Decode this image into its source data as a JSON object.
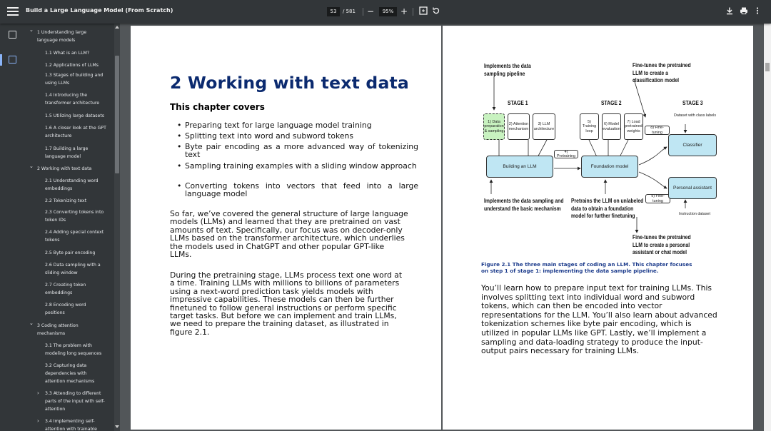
{
  "toolbar": {
    "title": "Build a Large Language Model (From Scratch)",
    "page_current": "53",
    "page_total": "/ 581",
    "zoom": "95%",
    "zoom_out": "−",
    "zoom_in": "+"
  },
  "toc": [
    {
      "label": "1 Understanding large language models",
      "level": 0
    },
    {
      "label": "1.1 What is an LLM?",
      "level": 1
    },
    {
      "label": "1.2 Applications of LLMs",
      "level": 1
    },
    {
      "label": "1.3 Stages of building and using LLMs",
      "level": 1
    },
    {
      "label": "1.4 Introducing the transformer architecture",
      "level": 1
    },
    {
      "label": "1.5 Utilizing large datasets",
      "level": 1
    },
    {
      "label": "1.6 A closer look at the GPT architecture",
      "level": 1
    },
    {
      "label": "1.7 Building a large language model",
      "level": 1
    },
    {
      "label": "2 Working with text data",
      "level": 0
    },
    {
      "label": "2.1 Understanding word embeddings",
      "level": 1
    },
    {
      "label": "2.2 Tokenizing text",
      "level": 1
    },
    {
      "label": "2.3 Converting tokens into token IDs",
      "level": 1
    },
    {
      "label": "2.4 Adding special context tokens",
      "level": 1
    },
    {
      "label": "2.5 Byte pair encoding",
      "level": 1
    },
    {
      "label": "2.6 Data sampling with a sliding window",
      "level": 1
    },
    {
      "label": "2.7 Creating token embeddings",
      "level": 1
    },
    {
      "label": "2.8 Encoding word positions",
      "level": 1
    },
    {
      "label": "3 Coding attention mechanisms",
      "level": 0
    },
    {
      "label": "3.1 The problem with modeling long sequences",
      "level": 1
    },
    {
      "label": "3.2 Capturing data dependencies with attention mechanisms",
      "level": 1
    },
    {
      "label": "3.3 Attending to different parts of the input with self-attention",
      "level": 1
    },
    {
      "label": "3.4 Implementing self-attention with trainable",
      "level": 1
    }
  ],
  "left_page": {
    "chapter_title": "2 Working with text data",
    "covers_heading": "This chapter covers",
    "bullets": [
      "Preparing text for large language model training",
      "Splitting text into word and subword tokens",
      "Byte pair encoding as a more advanced way of tokenizing text",
      "Sampling training examples with a sliding window approach",
      "Converting tokens into vectors that feed into a large language model"
    ],
    "para1": [
      "So far, we’ve covered the general structure of large language",
      "models (LLMs) and learned that they are pretrained on vast",
      "amounts of text. Specifically, our focus was on decoder-only",
      "LLMs based on the transformer architecture, which underlies",
      "the models used in ChatGPT and other popular GPT-like",
      "LLMs."
    ],
    "para2": [
      "During the pretraining stage, LLMs process text one word at",
      "a time. Training LLMs with millions to billions of parameters",
      "using a next-word prediction task yields models with",
      "impressive capabilities. These models can then be further",
      "finetuned to follow general instructions or perform specific",
      "target tasks. But before we can implement and train LLMs,",
      "we need to prepare the training dataset, as illustrated in",
      "figure 2.1."
    ]
  },
  "right_page": {
    "figure": {
      "ann_top_left": [
        "Implements the data",
        "sampling pipeline"
      ],
      "ann_top_right": [
        "Fine-tunes the pretrained",
        "LLM to create a",
        "classification model"
      ],
      "stage1": "STAGE 1",
      "stage2": "STAGE 2",
      "stage3": "STAGE 3",
      "step1": [
        "1) Data",
        "preparation",
        "& sampling"
      ],
      "step2": [
        "2) Attention",
        "mechanism"
      ],
      "step3": [
        "3) LLM",
        "architecture"
      ],
      "step4": "4) Pretraining",
      "step5": [
        "5) Training",
        "loop"
      ],
      "step6": [
        "6) Model",
        "evaluation"
      ],
      "step7": [
        "7) Load",
        "pretrained",
        "weights"
      ],
      "step8": "8) Fine-tuning",
      "step9": "9) Fine-tuning",
      "dataset_labels": "Dataset with class labels",
      "instruction_dataset": "Instruction dataset",
      "building_llm": "Building an LLM",
      "foundation_model": "Foundation model",
      "classifier": "Classifier",
      "personal_assistant": "Personal assistant",
      "ann_bottom_left": [
        "Implements the data sampling and",
        "understand the basic mechanism"
      ],
      "ann_bottom_mid": [
        "Pretrains the LLM on unlabeled",
        "data to obtain a foundation",
        "model for further finetuning"
      ],
      "ann_bottom_right": [
        "Fine-tunes the pretrained",
        "LLM to create a personal",
        "assistant or chat model"
      ]
    },
    "caption": [
      "Figure 2.1 The three main stages of coding an LLM. This chapter focuses",
      "on step 1 of stage 1: implementing the data sample pipeline."
    ],
    "para": [
      "You’ll learn how to prepare input text for training LLMs. This",
      "involves splitting text into individual word and subword",
      "tokens, which can then be encoded into vector",
      "representations for the LLM. You’ll also learn about advanced",
      "tokenization schemes like byte pair encoding, which is",
      "utilized in popular LLMs like GPT. Lastly, we’ll implement a",
      "sampling and data-loading strategy to produce the input-",
      "output pairs necessary for training LLMs."
    ]
  }
}
